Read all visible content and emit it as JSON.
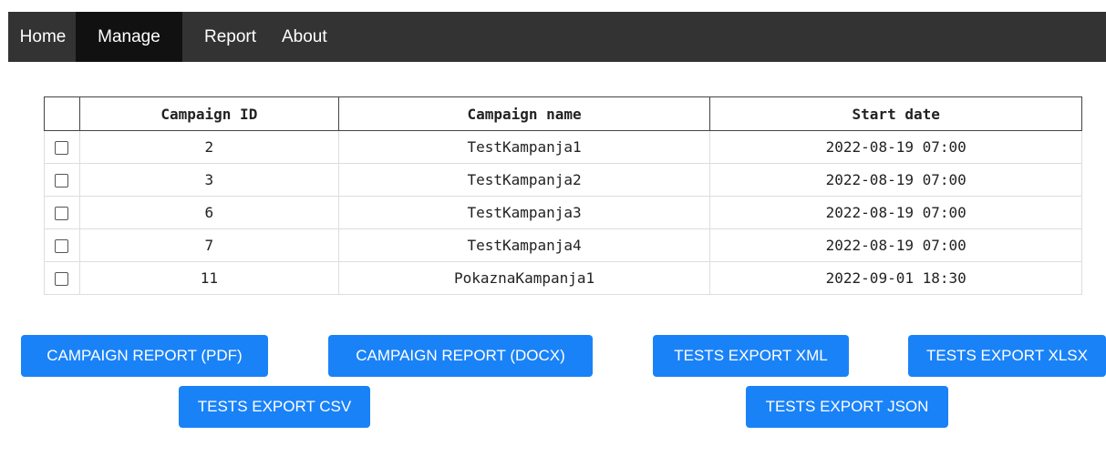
{
  "nav": {
    "items": [
      {
        "label": "Home",
        "active": false
      },
      {
        "label": "Manage",
        "active": true
      },
      {
        "label": "Report",
        "active": false
      },
      {
        "label": "About",
        "active": false
      }
    ]
  },
  "table": {
    "headers": [
      "",
      "Campaign ID",
      "Campaign name",
      "Start date"
    ],
    "rows": [
      {
        "checked": false,
        "id": "2",
        "name": "TestKampanja1",
        "start": "2022-08-19 07:00"
      },
      {
        "checked": false,
        "id": "3",
        "name": "TestKampanja2",
        "start": "2022-08-19 07:00"
      },
      {
        "checked": false,
        "id": "6",
        "name": "TestKampanja3",
        "start": "2022-08-19 07:00"
      },
      {
        "checked": false,
        "id": "7",
        "name": "TestKampanja4",
        "start": "2022-08-19 07:00"
      },
      {
        "checked": false,
        "id": "11",
        "name": "PokaznaKampanja1",
        "start": "2022-09-01 18:30"
      }
    ]
  },
  "buttons": {
    "report_pdf": "CAMPAIGN REPORT (PDF)",
    "report_docx": "CAMPAIGN REPORT (DOCX)",
    "export_xml": "TESTS EXPORT XML",
    "export_xlsx": "TESTS EXPORT XLSX",
    "export_csv": "TESTS EXPORT CSV",
    "export_json": "TESTS EXPORT JSON"
  },
  "colors": {
    "navbar_bg": "#333333",
    "navbar_active_bg": "#111111",
    "button_bg": "#1a82f7"
  }
}
